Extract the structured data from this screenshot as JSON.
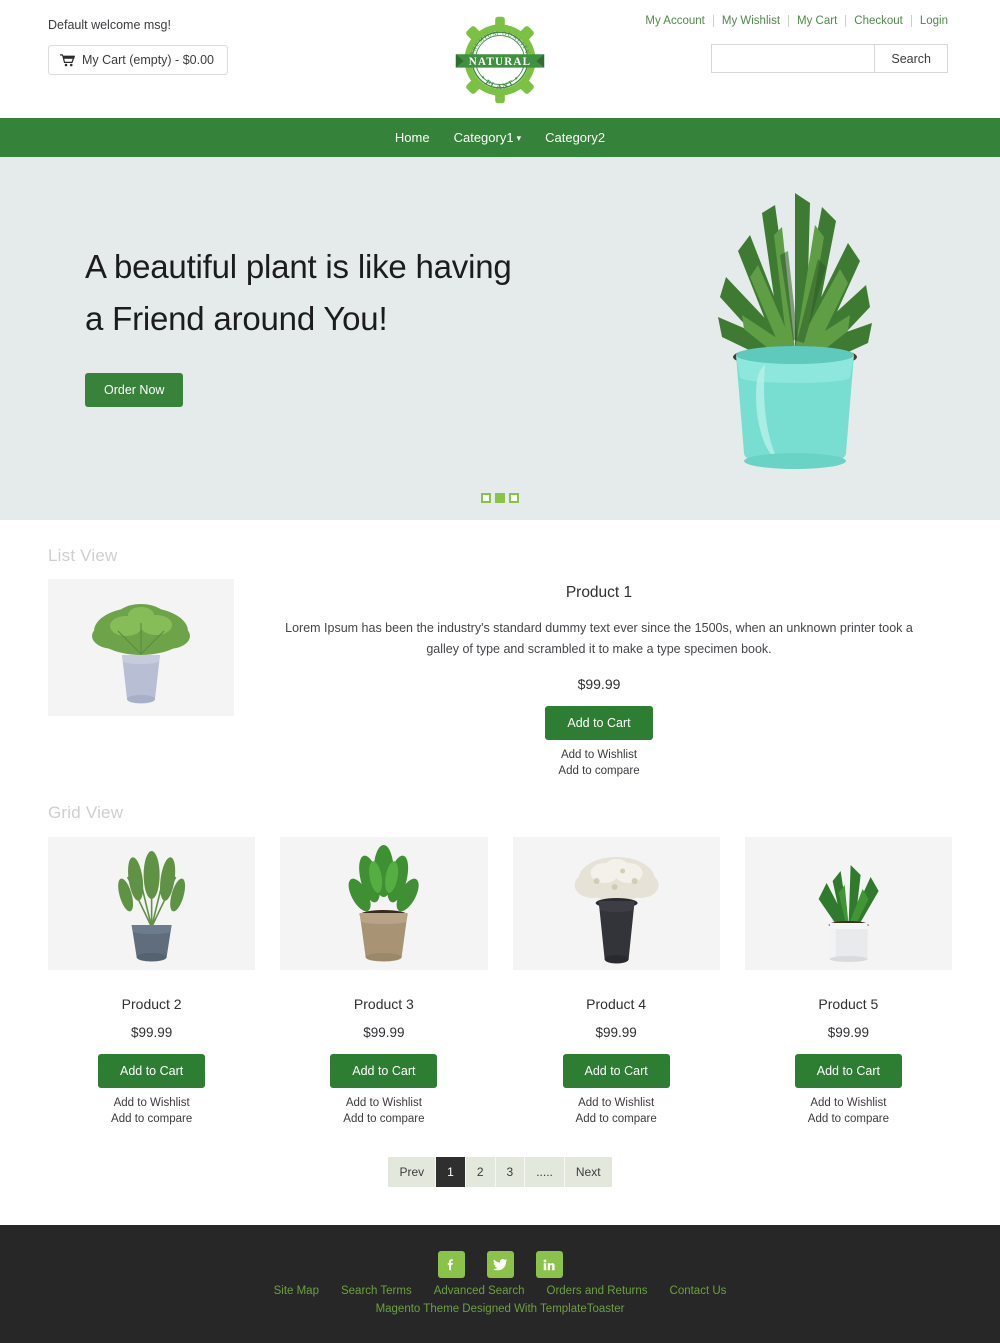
{
  "header": {
    "welcome_message": "Default welcome msg!",
    "cart_summary": "My Cart (empty) - $0.00",
    "cart_icon": "shopping-cart-icon",
    "logo": {
      "arc_text": "PREMIUM QUALITY",
      "ribbon_text": "NATURAL",
      "bottom_text": "• PLANT •"
    },
    "top_links": [
      {
        "label": "My Account"
      },
      {
        "label": "My Wishlist"
      },
      {
        "label": "My Cart"
      },
      {
        "label": "Checkout"
      },
      {
        "label": "Login"
      }
    ],
    "search": {
      "value": "",
      "placeholder": "",
      "button_label": "Search"
    }
  },
  "nav": {
    "items": [
      {
        "label": "Home",
        "has_dropdown": false
      },
      {
        "label": "Category1",
        "has_dropdown": true
      },
      {
        "label": "Category2",
        "has_dropdown": false
      }
    ]
  },
  "hero": {
    "headline_line1": "A beautiful plant is like having",
    "headline_line2": "a Friend around You!",
    "cta_label": "Order Now",
    "image_alt": "haworthia-succulent-in-mint-pot",
    "slides": 3,
    "active_slide": 2
  },
  "list_view": {
    "title": "List View",
    "product": {
      "name": "Product 1",
      "description": "Lorem Ipsum has been the industry's standard dummy text ever since the 1500s, when an unknown printer took a galley of type and scrambled it to make a type specimen book.",
      "price": "$99.99",
      "add_to_cart": "Add to Cart",
      "wishlist": "Add to Wishlist",
      "compare": "Add to compare",
      "image_alt": "green-shrub-in-lavender-pot"
    }
  },
  "grid_view": {
    "title": "Grid View",
    "add_to_cart": "Add to Cart",
    "wishlist": "Add to Wishlist",
    "compare": "Add to compare",
    "products": [
      {
        "name": "Product 2",
        "price": "$99.99",
        "image_alt": "rosemary-in-blue-gray-pot"
      },
      {
        "name": "Product 3",
        "price": "$99.99",
        "image_alt": "zz-plant-in-terracotta-pot"
      },
      {
        "name": "Product 4",
        "price": "$99.99",
        "image_alt": "white-flowers-in-charcoal-pot"
      },
      {
        "name": "Product 5",
        "price": "$99.99",
        "image_alt": "zigzag-cactus-in-white-pot"
      }
    ]
  },
  "pagination": {
    "prev_label": "Prev",
    "next_label": "Next",
    "pages": [
      "1",
      "2",
      "3",
      "....."
    ],
    "active_page": "1"
  },
  "footer": {
    "social": [
      {
        "name": "facebook",
        "glyph": "f"
      },
      {
        "name": "twitter",
        "glyph": "t"
      },
      {
        "name": "linkedin",
        "glyph": "in"
      }
    ],
    "links": [
      {
        "label": "Site Map"
      },
      {
        "label": "Search Terms"
      },
      {
        "label": "Advanced Search"
      },
      {
        "label": "Orders and Returns"
      },
      {
        "label": "Contact Us"
      }
    ],
    "copyright": "Magento Theme Designed With TemplateToaster"
  },
  "colors": {
    "nav_green": "#35823a",
    "button_green": "#2d7d32",
    "accent_light_green": "#8bc34a",
    "hero_bg": "#e4ebea",
    "footer_bg": "#272727",
    "footer_link": "#6ba13d",
    "pagination_bg": "#e3e8dc",
    "pagination_active": "#2f2f2f"
  }
}
